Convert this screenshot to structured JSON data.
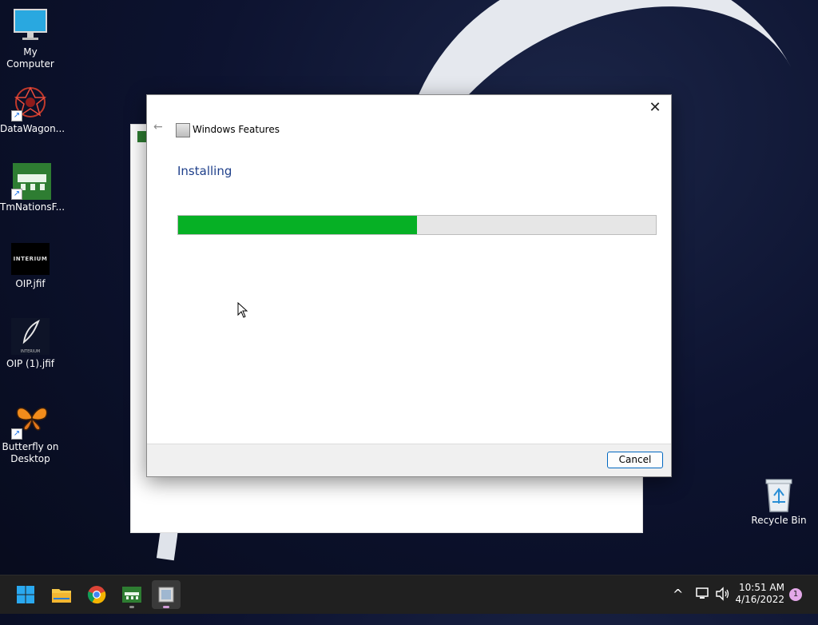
{
  "desktop": {
    "icons": [
      {
        "label": "My Computer"
      },
      {
        "label": "DataWagon..."
      },
      {
        "label": "TmNationsF..."
      },
      {
        "label": "OIP.jfif",
        "thumb_text": "INTERIUM"
      },
      {
        "label": "OIP (1).jfif",
        "thumb_text": "INTERIUM"
      },
      {
        "label": "Butterfly on Desktop"
      },
      {
        "label": "Recycle Bin"
      }
    ]
  },
  "dialog": {
    "title": "Windows Features",
    "heading": "Installing",
    "progress": 0.5,
    "cancel_label": "Cancel",
    "close_glyph": "✕",
    "back_glyph": "←"
  },
  "taskbar": {
    "time": "10:51 AM",
    "date": "4/16/2022",
    "notification_count": "1",
    "overflow_glyph": "^"
  },
  "colors": {
    "progress_fill": "#06b025",
    "heading": "#1e3f8a",
    "accent": "#0067c0"
  }
}
